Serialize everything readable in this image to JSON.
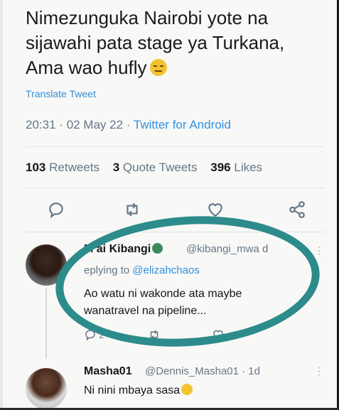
{
  "tweet": {
    "lines": [
      "Nimezunguka Nairobi yote na",
      "sijawahi pata stage ya Turkana,",
      "Ama wao hufly"
    ],
    "emoji": "unamused-face-emoji",
    "translate_label": "Translate Tweet",
    "time": "20:31",
    "sep": "·",
    "date": "02 May 22",
    "source": "Twitter for Android"
  },
  "stats": {
    "retweets_count": "103",
    "retweets_label": "Retweets",
    "quotes_count": "3",
    "quotes_label": "Quote Tweets",
    "likes_count": "396",
    "likes_label": "Likes"
  },
  "actions": [
    "reply-icon",
    "retweet-icon",
    "like-icon",
    "share-icon"
  ],
  "reply1": {
    "name": "M  ai Kibangi",
    "handle": "@kibangi_mwa   d",
    "replying_prefix": "eplying to",
    "replying_to": "@elizahchaos",
    "body": [
      "Ao watu ni wakonde ata maybe",
      "wanatravel na pipeline..."
    ],
    "reply_count": "2",
    "retweet_count": "",
    "like_count": "4",
    "annotation_color": "#2d8b8b"
  },
  "reply2": {
    "name": "Masha01",
    "handle": "@Dennis_Masha01 · 1d",
    "body": "Ni nini mbaya sasa"
  },
  "colors": {
    "link": "#2f8fe0",
    "muted": "#657786"
  }
}
